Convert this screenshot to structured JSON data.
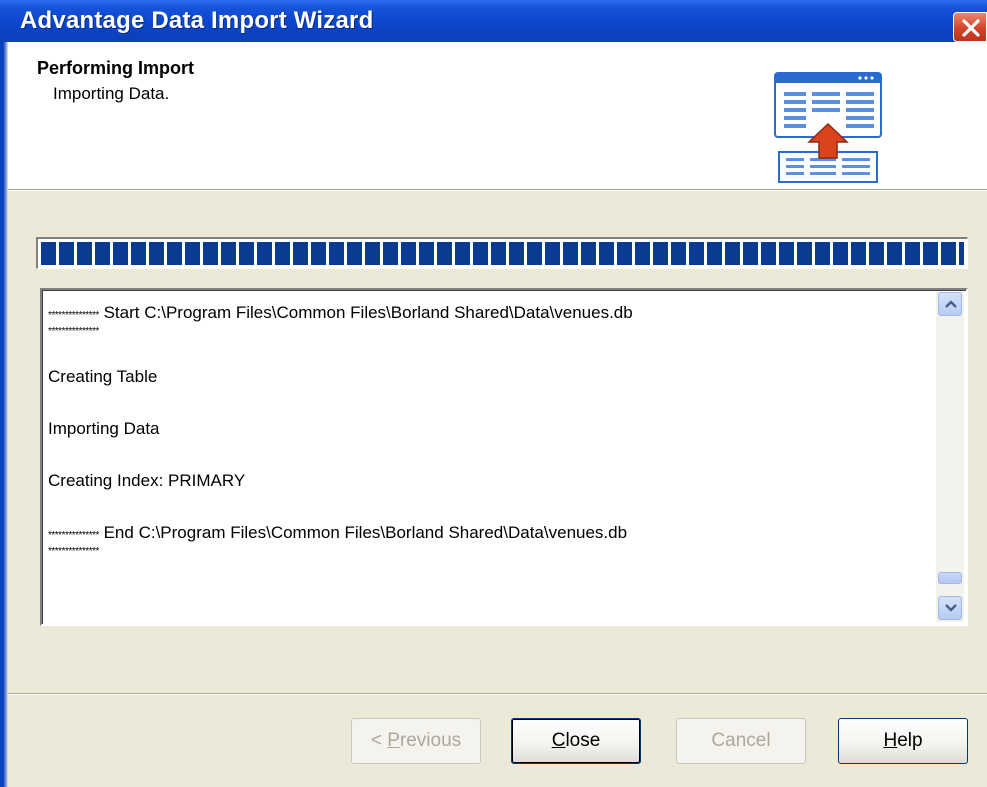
{
  "window": {
    "title": "Advantage Data Import Wizard",
    "close_label": "Close window"
  },
  "header": {
    "title": "Performing Import",
    "subtitle": "Importing Data.",
    "icon": "import-table-icon"
  },
  "progress": {
    "fraction": 1.0
  },
  "log": {
    "start_prefix": "***************",
    "start_text": " Start C:\\Program Files\\Common Files\\Borland Shared\\Data\\venues.db",
    "start_suffix": "***************",
    "line_create_table": "Creating Table",
    "line_import_data": "Importing Data",
    "line_create_index": "Creating Index: PRIMARY",
    "end_prefix": "***************",
    "end_text": " End C:\\Program Files\\Common Files\\Borland Shared\\Data\\venues.db",
    "end_suffix": "***************"
  },
  "buttons": {
    "previous": {
      "pre": "< ",
      "accel": "P",
      "rest": "revious"
    },
    "close": {
      "accel": "C",
      "rest": "lose"
    },
    "cancel": "Cancel",
    "help": {
      "accel": "H",
      "rest": "elp"
    }
  },
  "colors": {
    "title_bar": "#0a44c8",
    "progress_block": "#0b3a93",
    "dialog_bg": "#ece9d8",
    "close_button": "#d4442a"
  }
}
